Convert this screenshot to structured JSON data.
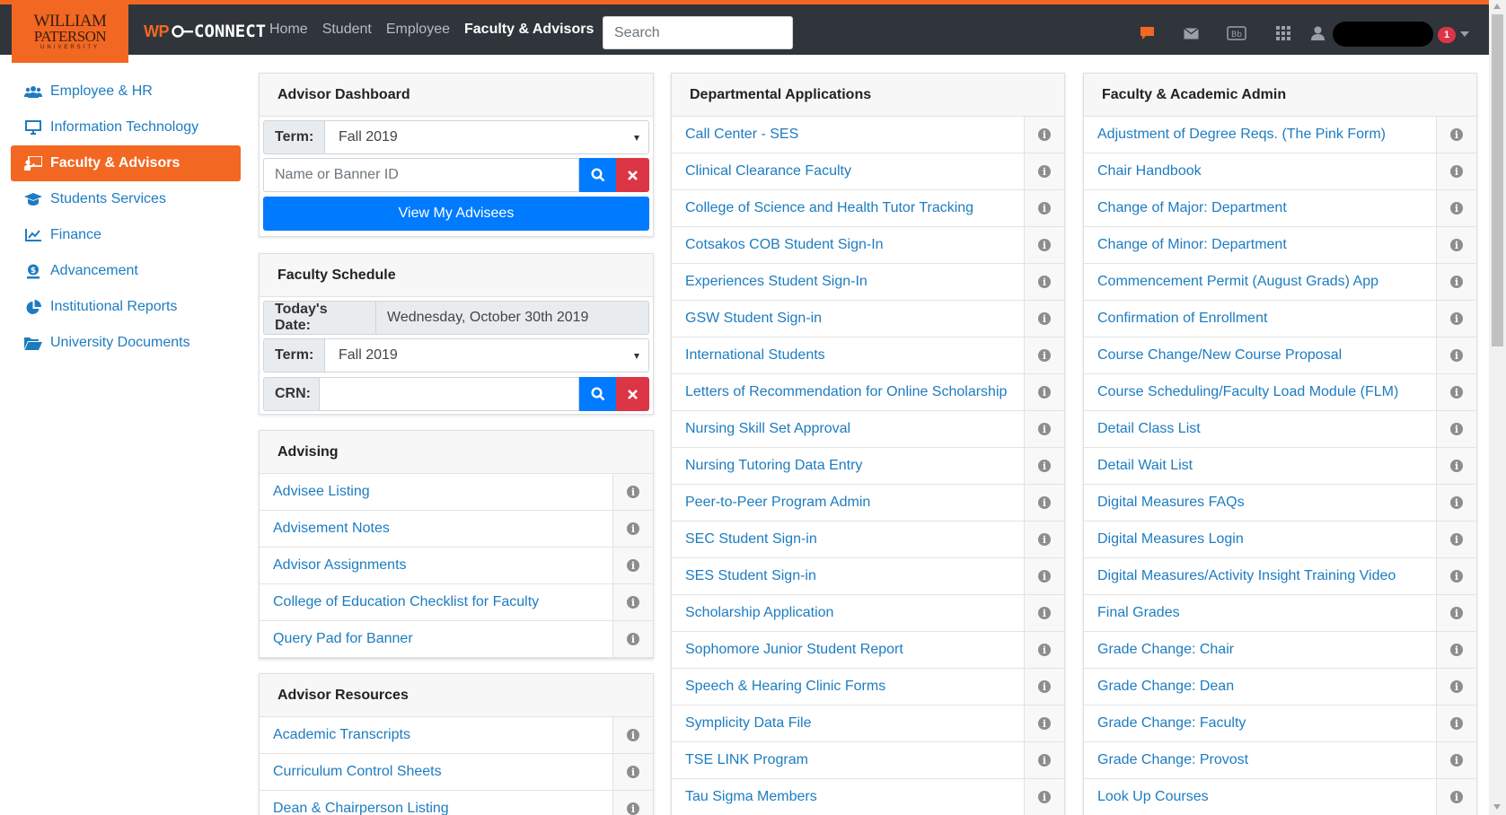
{
  "header": {
    "logo": {
      "line1": "WILLIAM",
      "line2": "PATERSON",
      "line3": "UNIVERSITY"
    },
    "brand": {
      "prefix": "WP",
      "suffix": "CONNECT"
    },
    "nav": [
      {
        "label": "Home",
        "active": false
      },
      {
        "label": "Student",
        "active": false
      },
      {
        "label": "Employee",
        "active": false
      },
      {
        "label": "Faculty & Advisors",
        "active": true
      }
    ],
    "search_placeholder": "Search",
    "notification_count": "1",
    "icons": [
      "chat-icon",
      "mail-icon",
      "blackboard-icon",
      "apps-grid-icon",
      "user-icon"
    ],
    "accent_color": "#f26722"
  },
  "sidebar": {
    "items": [
      {
        "label": "Employee & HR",
        "icon": "users-icon",
        "active": false
      },
      {
        "label": "Information Technology",
        "icon": "monitor-icon",
        "active": false
      },
      {
        "label": "Faculty & Advisors",
        "icon": "chalkboard-teacher-icon",
        "active": true
      },
      {
        "label": "Students Services",
        "icon": "graduation-cap-icon",
        "active": false
      },
      {
        "label": "Finance",
        "icon": "line-chart-icon",
        "active": false
      },
      {
        "label": "Advancement",
        "icon": "donate-icon",
        "active": false
      },
      {
        "label": "Institutional Reports",
        "icon": "pie-chart-icon",
        "active": false
      },
      {
        "label": "University Documents",
        "icon": "folder-open-icon",
        "active": false
      }
    ]
  },
  "advisor_dashboard": {
    "title": "Advisor Dashboard",
    "term_label": "Term:",
    "term_value": "Fall 2019",
    "search_placeholder": "Name or Banner ID",
    "view_button": "View My Advisees"
  },
  "faculty_schedule": {
    "title": "Faculty Schedule",
    "date_label": "Today's Date:",
    "date_value": "Wednesday, October 30th 2019",
    "term_label": "Term:",
    "term_value": "Fall 2019",
    "crn_label": "CRN:"
  },
  "advising": {
    "title": "Advising",
    "links": [
      "Advisee Listing",
      "Advisement Notes",
      "Advisor Assignments",
      "College of Education Checklist for Faculty",
      "Query Pad for Banner"
    ]
  },
  "advisor_resources": {
    "title": "Advisor Resources",
    "links": [
      "Academic Transcripts",
      "Curriculum Control Sheets",
      "Dean & Chairperson Listing"
    ]
  },
  "departmental_applications": {
    "title": "Departmental Applications",
    "links": [
      "Call Center - SES",
      "Clinical Clearance Faculty",
      "College of Science and Health Tutor Tracking",
      "Cotsakos COB Student Sign-In",
      "Experiences Student Sign-In",
      "GSW Student Sign-in",
      "International Students",
      "Letters of Recommendation for Online Scholarship",
      "Nursing Skill Set Approval",
      "Nursing Tutoring Data Entry",
      "Peer-to-Peer Program Admin",
      "SEC Student Sign-in",
      "SES Student Sign-in",
      "Scholarship Application",
      "Sophomore Junior Student Report",
      "Speech & Hearing Clinic Forms",
      "Symplicity Data File",
      "TSE LINK Program",
      "Tau Sigma Members"
    ]
  },
  "faculty_academic_admin": {
    "title": "Faculty & Academic Admin",
    "links": [
      "Adjustment of Degree Reqs. (The Pink Form)",
      "Chair Handbook",
      "Change of Major: Department",
      "Change of Minor: Department",
      "Commencement Permit (August Grads) App",
      "Confirmation of Enrollment",
      "Course Change/New Course Proposal",
      "Course Scheduling/Faculty Load Module (FLM)",
      "Detail Class List",
      "Detail Wait List",
      "Digital Measures FAQs",
      "Digital Measures Login",
      "Digital Measures/Activity Insight Training Video",
      "Final Grades",
      "Grade Change: Chair",
      "Grade Change: Dean",
      "Grade Change: Faculty",
      "Grade Change: Provost",
      "Look Up Courses"
    ]
  }
}
